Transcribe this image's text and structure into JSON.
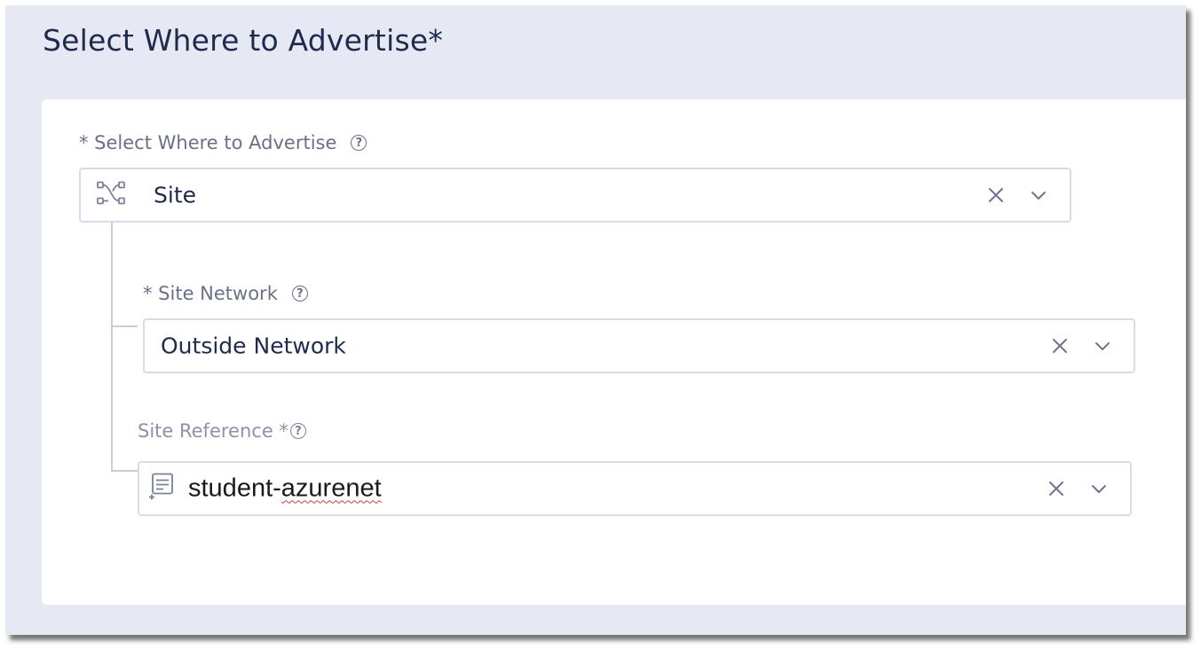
{
  "section": {
    "title": "Select Where to Advertise*"
  },
  "advertise_field": {
    "label": "* Select Where to Advertise",
    "value": "Site",
    "icon": "site-topology-icon"
  },
  "site_network_field": {
    "label": "* Site Network",
    "value": "Outside Network"
  },
  "site_reference_field": {
    "label": "Site Reference *",
    "value_prefix": "student-",
    "value_misspelled": "azurenet",
    "icon": "reference-list-icon"
  },
  "icons": {
    "help": "?",
    "clear": "clear-icon",
    "expand": "chevron-down-icon"
  },
  "colors": {
    "frame_bg": "#e6e8f4",
    "text": "#1f2a4d",
    "border": "#d9dce8"
  }
}
